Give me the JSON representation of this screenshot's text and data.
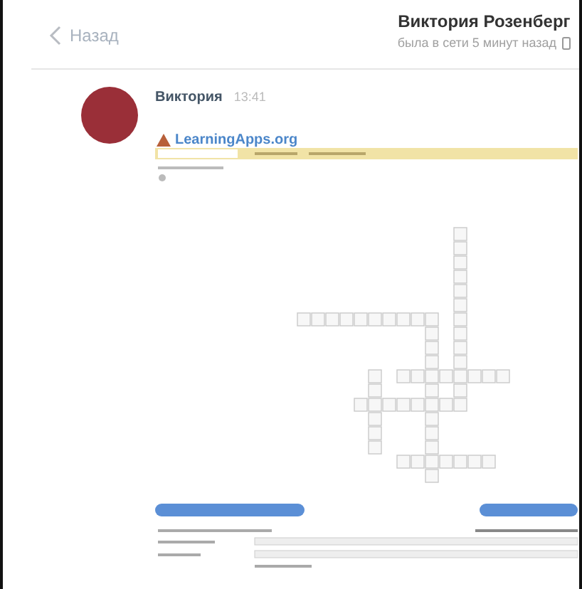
{
  "header": {
    "back": "Назад",
    "title": "Виктория Розенберг",
    "status": "была в сети 5 минут назад"
  },
  "message": {
    "author": "Виктория",
    "time": "13:41",
    "attachment": {
      "site": "LearningApps.org"
    }
  }
}
